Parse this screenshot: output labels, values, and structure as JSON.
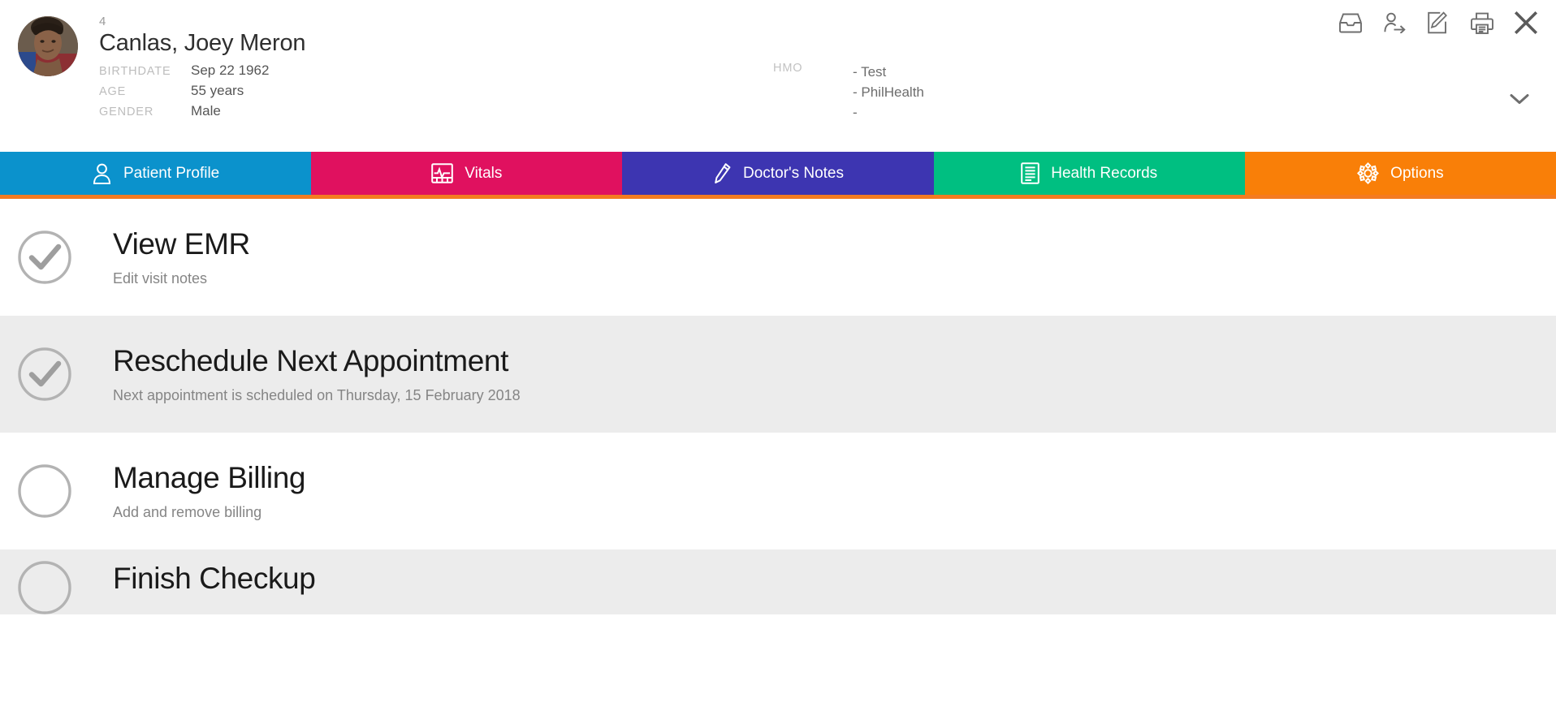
{
  "patient": {
    "record_number": "4",
    "name": "Canlas, Joey Meron",
    "fields": [
      {
        "label": "BIRTHDATE",
        "value": "Sep 22 1962"
      },
      {
        "label": "AGE",
        "value": "55 years"
      },
      {
        "label": "GENDER",
        "value": "Male"
      }
    ],
    "hmo_label": "HMO",
    "hmo_values": [
      "- Test",
      "- PhilHealth",
      "-"
    ]
  },
  "header_icons": [
    {
      "name": "inbox-icon"
    },
    {
      "name": "refer-patient-icon"
    },
    {
      "name": "edit-note-icon"
    },
    {
      "name": "print-icon"
    },
    {
      "name": "close-icon"
    }
  ],
  "expand_icon": "chevron-down-icon",
  "tabs": [
    {
      "label": "Patient Profile",
      "icon": "person-icon",
      "color": "#0b92cc"
    },
    {
      "label": "Vitals",
      "icon": "heart-monitor-icon",
      "color": "#e0115f"
    },
    {
      "label": "Doctor's Notes",
      "icon": "pencil-icon",
      "color": "#3d35b1"
    },
    {
      "label": "Health Records",
      "icon": "document-list-icon",
      "color": "#00bf81"
    },
    {
      "label": "Options",
      "icon": "gear-icon",
      "color": "#f97f08"
    }
  ],
  "tab_underline_color": "#f47b20",
  "options": [
    {
      "title": "View EMR",
      "subtitle": "Edit visit notes",
      "checked": true,
      "background": "#ffffff"
    },
    {
      "title": "Reschedule Next Appointment",
      "subtitle": "Next appointment is scheduled on Thursday, 15 February 2018",
      "checked": true,
      "background": "#ececec"
    },
    {
      "title": "Manage Billing",
      "subtitle": "Add and remove billing",
      "checked": false,
      "background": "#ffffff"
    },
    {
      "title": "Finish Checkup",
      "subtitle": "",
      "checked": false,
      "background": "#ececec"
    }
  ]
}
